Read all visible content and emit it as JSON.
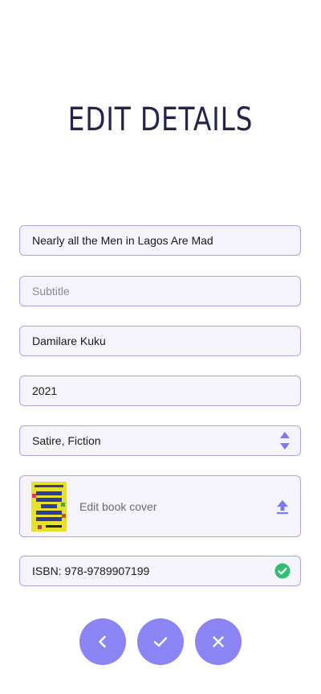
{
  "header": {
    "title": "EDIT DETAILS"
  },
  "form": {
    "title_value": "Nearly all the Men in Lagos Are Mad",
    "subtitle_placeholder": "Subtitle",
    "subtitle_value": "",
    "author_value": "Damilare Kuku",
    "year_value": "2021",
    "genre_value": "Satire, Fiction",
    "cover_label": "Edit book cover",
    "isbn_value": "ISBN: 978-9789907199",
    "isbn_status": "valid"
  },
  "actions": {
    "back_icon": "chevron-left-icon",
    "confirm_icon": "check-icon",
    "cancel_icon": "close-icon"
  },
  "colors": {
    "accent": "#8a84f4",
    "field_border": "#a9a4ef",
    "field_bg": "#f5f4fc",
    "title": "#24244f",
    "success": "#2fbf71"
  }
}
